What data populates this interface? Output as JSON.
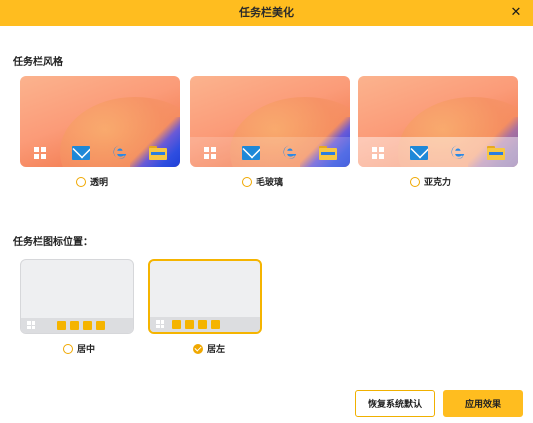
{
  "window": {
    "title": "任务栏美化",
    "close_symbol": "✕"
  },
  "styles_section": {
    "title": "任务栏风格",
    "options": [
      {
        "label": "透明",
        "selected": false
      },
      {
        "label": "毛玻璃",
        "selected": false
      },
      {
        "label": "亚克力",
        "selected": false
      }
    ],
    "taskbar_icons": [
      "windows-logo-icon",
      "mail-icon",
      "edge-browser-icon",
      "file-explorer-icon"
    ]
  },
  "position_section": {
    "title": "任务栏图标位置：",
    "options": [
      {
        "label": "居中",
        "selected": false
      },
      {
        "label": "居左",
        "selected": true
      }
    ]
  },
  "buttons": {
    "restore_default": "恢复系统默认",
    "apply": "应用效果"
  },
  "colors": {
    "accent": "#ffbd1f",
    "accent_border": "#f0a800",
    "card_bg": "#eeeff1"
  }
}
